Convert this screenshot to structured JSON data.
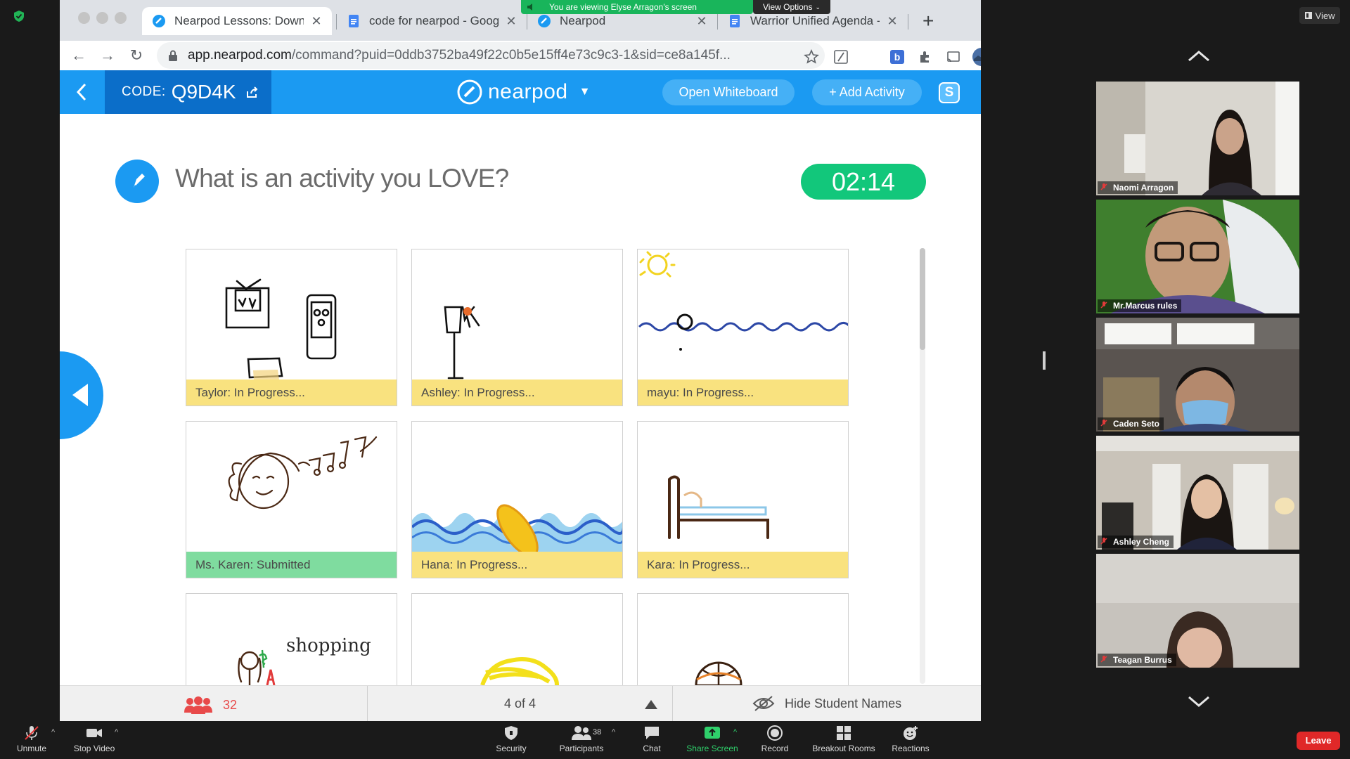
{
  "browser": {
    "tabs": [
      {
        "title": "Nearpod Lessons: Downlo",
        "icon": "nearpod-icon"
      },
      {
        "title": "code for nearpod - Googl",
        "icon": "docs-icon"
      },
      {
        "title": "Nearpod",
        "icon": "nearpod-icon"
      },
      {
        "title": "Warrior Unified Agenda - ",
        "icon": "docs-icon"
      }
    ],
    "url_host": "app.nearpod.com",
    "url_path": "/command?puid=0ddb3752ba49f22c0b5e15ff4e73c9c3-1&sid=ce8a145f..."
  },
  "share_banner": {
    "message": "You are viewing Elyse Arragon's screen",
    "view_options": "View Options"
  },
  "nearpod": {
    "code_label": "CODE:",
    "code_value": "Q9D4K",
    "logo_text": "nearpod",
    "open_whiteboard": "Open Whiteboard",
    "add_activity": "+ Add Activity",
    "s_badge": "S",
    "question": "What is an activity you LOVE?",
    "timer": "02:14",
    "responses": [
      {
        "status": "Taylor: In Progress..."
      },
      {
        "status": "Ashley: In Progress..."
      },
      {
        "status": "mayu: In Progress..."
      },
      {
        "status": "Ms. Karen: Submitted"
      },
      {
        "status": "Hana: In Progress..."
      },
      {
        "status": "Kara: In Progress..."
      },
      {
        "status": ""
      },
      {
        "status": ""
      },
      {
        "status": ""
      }
    ],
    "drawing_text": "shopping",
    "student_count": "32",
    "page_indicator": "4 of 4",
    "hide_names": "Hide Student Names"
  },
  "zoom": {
    "view_label": "View",
    "participants": [
      {
        "name": "Naomi Arragon"
      },
      {
        "name": "Mr.Marcus rules"
      },
      {
        "name": "Caden Seto"
      },
      {
        "name": "Ashley Cheng"
      },
      {
        "name": "Teagan Burrus"
      }
    ],
    "toolbar": {
      "unmute": "Unmute",
      "stop_video": "Stop Video",
      "security": "Security",
      "participants": "Participants",
      "participants_count": "38",
      "chat": "Chat",
      "share_screen": "Share Screen",
      "record": "Record",
      "breakout_rooms": "Breakout Rooms",
      "reactions": "Reactions",
      "leave": "Leave"
    }
  },
  "colors": {
    "nearpod_blue": "#1b9af2",
    "nearpod_dark_blue": "#0b6ec9",
    "timer_green": "#12c77b",
    "in_progress_yellow": "#f9e27f",
    "submitted_green": "#7fdc9f",
    "zoom_leave_red": "#e02828"
  }
}
